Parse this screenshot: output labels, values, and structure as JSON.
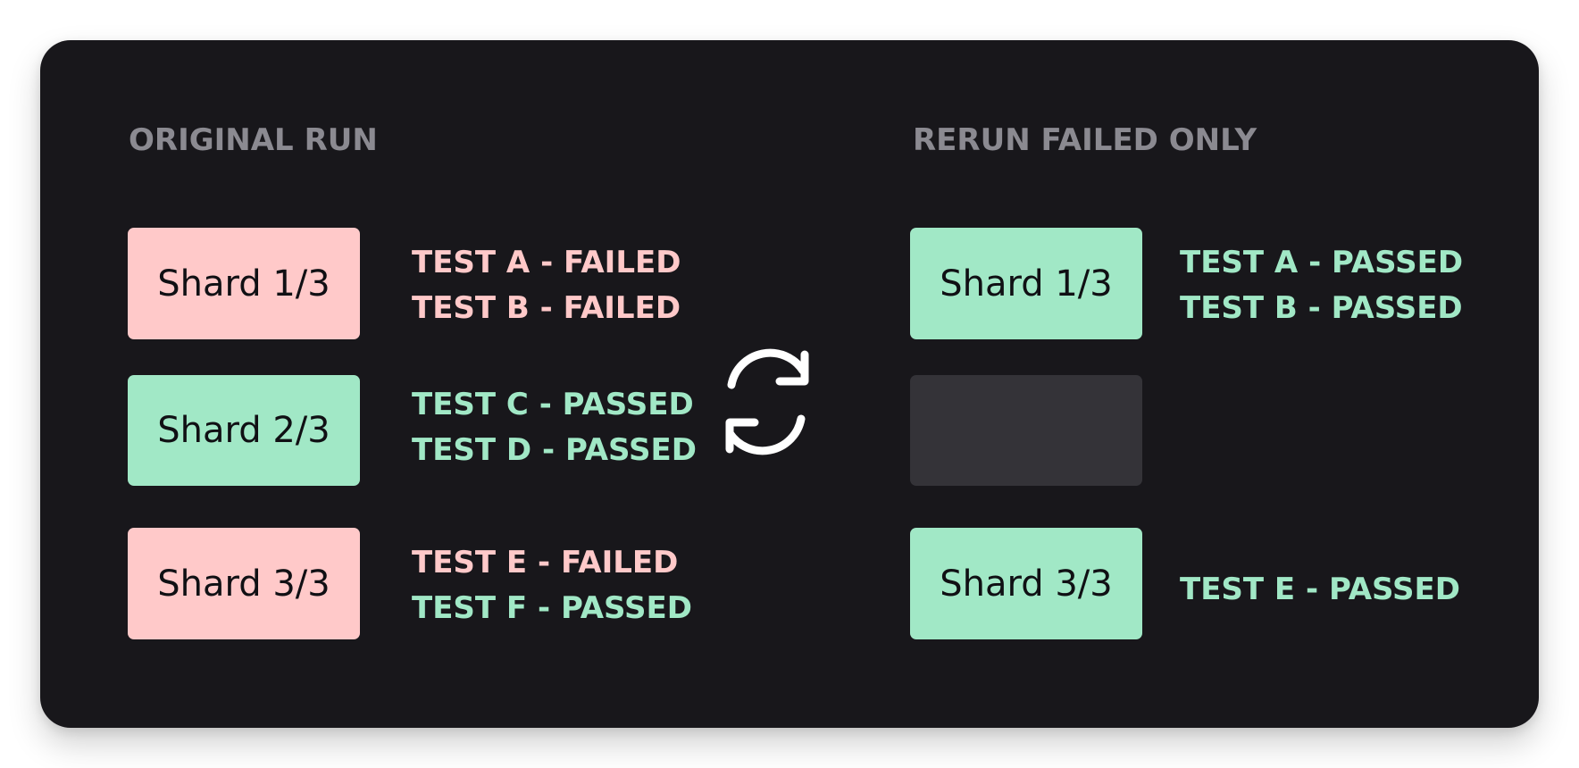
{
  "original": {
    "title": "ORIGINAL RUN",
    "shards": [
      {
        "label": "Shard 1/3",
        "status": "failed",
        "tests": [
          {
            "text": "TEST A - FAILED",
            "status": "failed"
          },
          {
            "text": "TEST B - FAILED",
            "status": "failed"
          }
        ]
      },
      {
        "label": "Shard 2/3",
        "status": "passed",
        "tests": [
          {
            "text": "TEST C - PASSED",
            "status": "passed"
          },
          {
            "text": "TEST D - PASSED",
            "status": "passed"
          }
        ]
      },
      {
        "label": "Shard 3/3",
        "status": "failed",
        "tests": [
          {
            "text": "TEST E - FAILED",
            "status": "failed"
          },
          {
            "text": "TEST F - PASSED",
            "status": "passed"
          }
        ]
      }
    ]
  },
  "rerun": {
    "title": "RERUN FAILED ONLY",
    "shards": [
      {
        "label": "Shard 1/3",
        "status": "passed",
        "tests": [
          {
            "text": "TEST A - PASSED",
            "status": "passed"
          },
          {
            "text": "TEST B - PASSED",
            "status": "passed"
          }
        ]
      },
      {
        "label": "",
        "status": "skipped",
        "tests": []
      },
      {
        "label": "Shard 3/3",
        "status": "passed",
        "tests": [
          {
            "text": "TEST E - PASSED",
            "status": "passed"
          }
        ]
      }
    ]
  },
  "icons": {
    "rerun": "refresh-icon"
  },
  "colors": {
    "background": "#18171b",
    "failed": "#ffc9c9",
    "passed": "#a1e8c6",
    "skipped": "#343338",
    "title": "#8b8a91"
  }
}
